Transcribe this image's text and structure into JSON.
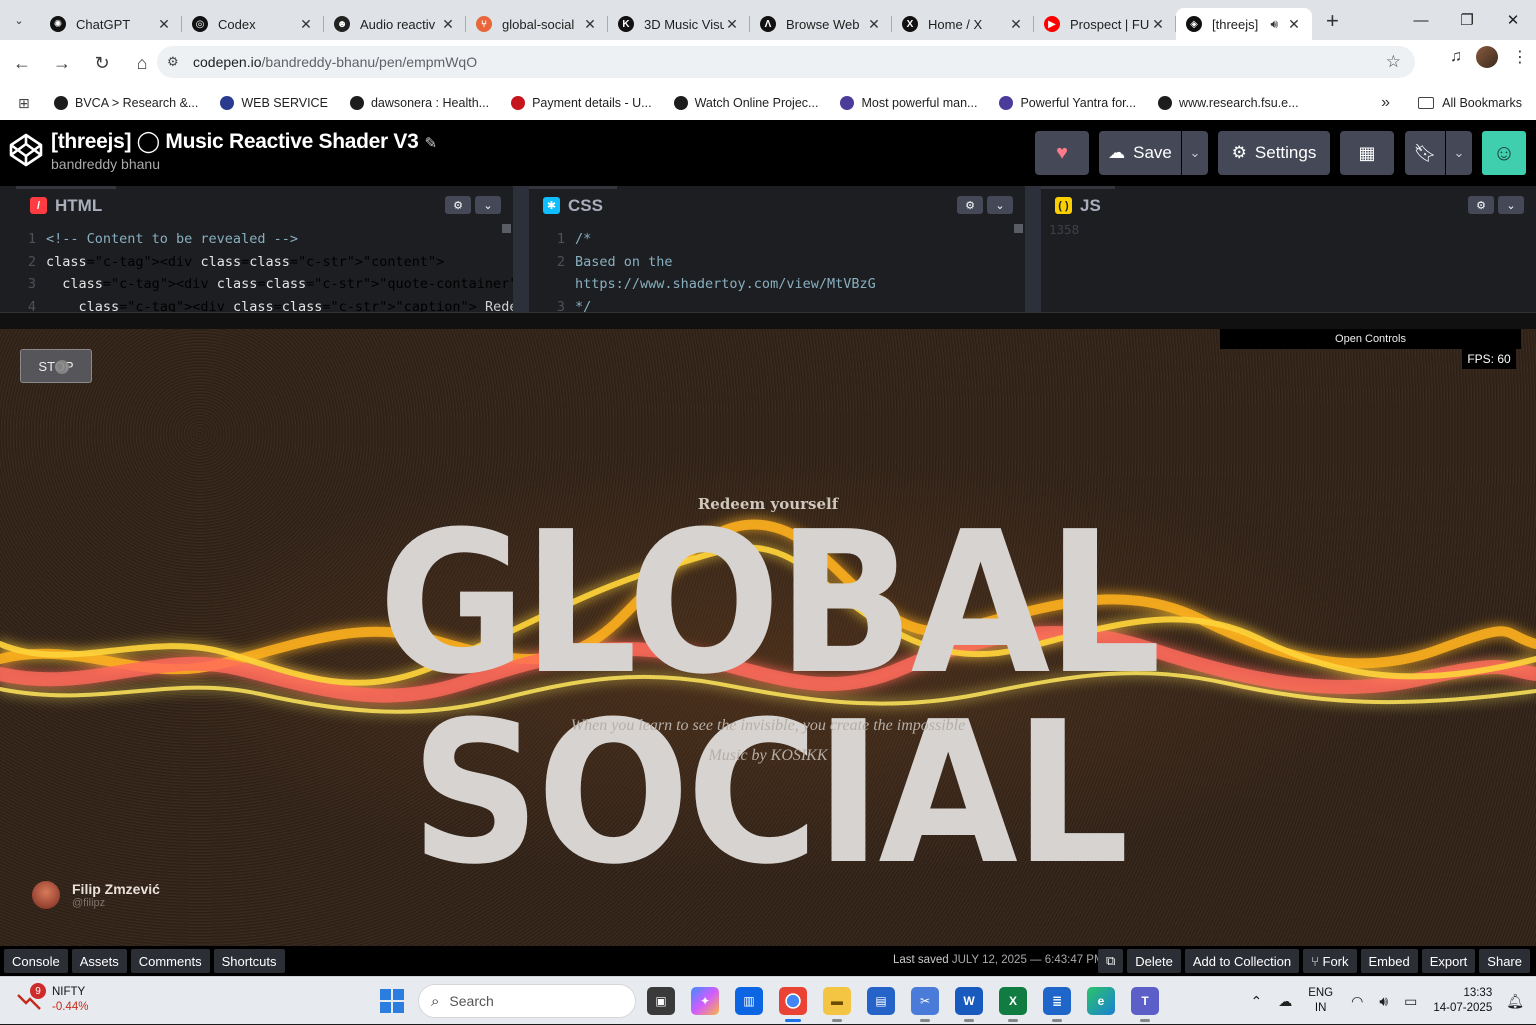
{
  "browser": {
    "tabs": [
      {
        "label": "ChatGPT",
        "icon": "chatgpt-icon",
        "color": "#111111",
        "glyph": "✺"
      },
      {
        "label": "Codex",
        "icon": "codex-icon",
        "color": "#111111",
        "glyph": "◎"
      },
      {
        "label": "Audio reactiv",
        "icon": "robot-icon",
        "color": "#222222",
        "glyph": "☻"
      },
      {
        "label": "global-social",
        "icon": "git-icon",
        "color": "#e8663a",
        "glyph": "⑂"
      },
      {
        "label": "3D Music Visu",
        "icon": "k-icon",
        "color": "#111111",
        "glyph": "K"
      },
      {
        "label": "Browse Web",
        "icon": "a-icon",
        "color": "#111111",
        "glyph": "Λ"
      },
      {
        "label": "Home / X",
        "icon": "x-icon",
        "color": "#111111",
        "glyph": "X"
      },
      {
        "label": "Prospect | FU",
        "icon": "youtube-icon",
        "color": "#ff0000",
        "glyph": "▶"
      },
      {
        "label": "[threejs]",
        "icon": "codepen-icon",
        "color": "#111111",
        "glyph": "◈"
      }
    ],
    "url_host": "codepen.io",
    "url_path": "/bandreddy-bhanu/pen/empmWqO",
    "bookmarks": [
      {
        "label": "BVCA > Research &...",
        "color": "#1d1d1d"
      },
      {
        "label": "WEB SERVICE",
        "color": "#2a3b8f"
      },
      {
        "label": "dawsonera : Health...",
        "color": "#1d1d1d"
      },
      {
        "label": "Payment details - U...",
        "color": "#c4161c"
      },
      {
        "label": "Watch Online Projec...",
        "color": "#1d1d1d"
      },
      {
        "label": "Most powerful man...",
        "color": "#4b3b9a"
      },
      {
        "label": "Powerful Yantra for...",
        "color": "#4b3b9a"
      },
      {
        "label": "www.research.fsu.e...",
        "color": "#1d1d1d"
      }
    ],
    "all_bookmarks": "All Bookmarks"
  },
  "codepen": {
    "title": "[threejs] ◯ Music Reactive Shader V3",
    "author": "bandreddy bhanu",
    "save_label": "Save",
    "settings_label": "Settings",
    "editors": {
      "html": {
        "label": "HTML",
        "color": "#ff3c41"
      },
      "css": {
        "label": "CSS",
        "color": "#0ebeff"
      },
      "js": {
        "label": "JS",
        "color": "#fcd000",
        "line_number": "1358"
      }
    },
    "html_code": [
      {
        "n": "1",
        "text": "<!-- Content to be revealed -->"
      },
      {
        "n": "2",
        "text": "<div class=\"content\">"
      },
      {
        "n": "3",
        "text": "  <div class=\"quote-container\">"
      },
      {
        "n": "4",
        "text": "    <div class=\"caption\"> Redeem yourself </div>"
      }
    ],
    "css_code": [
      {
        "n": "1",
        "text": "/*"
      },
      {
        "n": "2",
        "text": "Based on the"
      },
      {
        "n": "",
        "text": "https://www.shadertoy.com/view/MtVBzG"
      },
      {
        "n": "3",
        "text": "*/"
      }
    ],
    "footer": {
      "left_buttons": [
        "Console",
        "Assets",
        "Comments",
        "Shortcuts"
      ],
      "last_saved_label": "Last saved",
      "last_saved_date": "JULY 12, 2025 — 6:43:47 PM",
      "right_buttons": [
        "Delete",
        "Add to Collection",
        "Fork",
        "Embed",
        "Export",
        "Share"
      ]
    }
  },
  "preview": {
    "stop_label": "STOP",
    "open_controls": "Open Controls",
    "fps": "FPS: 60",
    "caption": "Redeem yourself",
    "headline": "GLOBAL SOCIAL",
    "quote": "When you learn to see the invisible, you create the impossible",
    "music": "Music by KOSIKK",
    "credit_name": "Filip Zmzević",
    "credit_handle": "@filipz"
  },
  "taskbar": {
    "stock_name": "NIFTY",
    "stock_change": "-0.44%",
    "notifications": "9",
    "search_placeholder": "Search",
    "lang_1": "ENG",
    "lang_2": "IN",
    "time": "13:33",
    "date": "14-07-2025"
  }
}
